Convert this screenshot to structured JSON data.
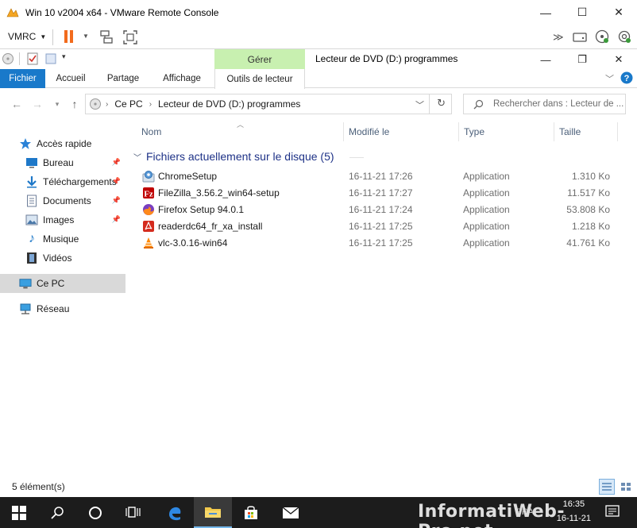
{
  "window": {
    "title": "Win 10 v2004 x64 - VMware Remote Console"
  },
  "vmrc": {
    "menu_label": "VMRC"
  },
  "ribbon": {
    "context_tab_group": "Gérer",
    "title": "Lecteur de DVD (D:) programmes",
    "tabs": [
      "Fichier",
      "Accueil",
      "Partage",
      "Affichage",
      "Outils de lecteur"
    ]
  },
  "address": {
    "crumbs": [
      "Ce PC",
      "Lecteur de DVD (D:) programmes"
    ],
    "search_placeholder": "Rechercher dans : Lecteur de ..."
  },
  "nav": {
    "quick_access": "Accès rapide",
    "items": [
      {
        "label": "Bureau",
        "pinned": true
      },
      {
        "label": "Téléchargements",
        "pinned": true
      },
      {
        "label": "Documents",
        "pinned": true
      },
      {
        "label": "Images",
        "pinned": true
      },
      {
        "label": "Musique",
        "pinned": false
      },
      {
        "label": "Vidéos",
        "pinned": false
      }
    ],
    "this_pc": "Ce PC",
    "network": "Réseau"
  },
  "columns": {
    "name": "Nom",
    "modified": "Modifié le",
    "type": "Type",
    "size": "Taille"
  },
  "group": {
    "label": "Fichiers actuellement sur le disque (5)"
  },
  "files": [
    {
      "name": "ChromeSetup",
      "date": "16-11-21 17:26",
      "type": "Application",
      "size": "1.310 Ko",
      "icon": "chrome-setup-icon"
    },
    {
      "name": "FileZilla_3.56.2_win64-setup",
      "date": "16-11-21 17:27",
      "type": "Application",
      "size": "11.517 Ko",
      "icon": "filezilla-icon"
    },
    {
      "name": "Firefox Setup 94.0.1",
      "date": "16-11-21 17:24",
      "type": "Application",
      "size": "53.808 Ko",
      "icon": "firefox-icon"
    },
    {
      "name": "readerdc64_fr_xa_install",
      "date": "16-11-21 17:25",
      "type": "Application",
      "size": "1.218 Ko",
      "icon": "acrobat-reader-icon"
    },
    {
      "name": "vlc-3.0.16-win64",
      "date": "16-11-21 17:25",
      "type": "Application",
      "size": "41.761 Ko",
      "icon": "vlc-icon"
    }
  ],
  "status": {
    "count": "5 élément(s)"
  },
  "taskbar": {
    "time": "16:35",
    "date": "16-11-21",
    "lang": "FRA",
    "watermark": "InformatiWeb-Pro.net"
  },
  "colors": {
    "fichier_tab": "#1979ca",
    "manage_tab": "#c8f0b0",
    "selection": "#d9d9d9",
    "group_header": "#1e3287",
    "taskbar": "#1c1c1c"
  }
}
